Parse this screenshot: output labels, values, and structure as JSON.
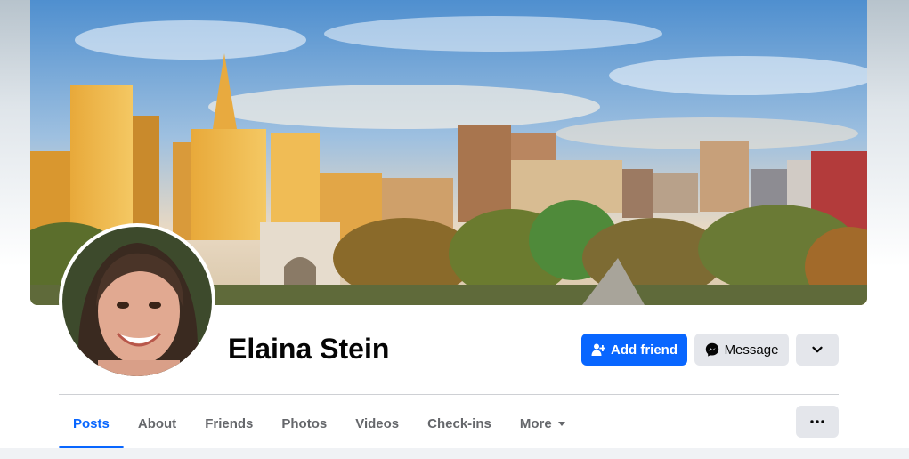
{
  "profile": {
    "name": "Elaina Stein"
  },
  "actions": {
    "add_friend_label": "Add friend",
    "message_label": "Message"
  },
  "tabs": [
    {
      "label": "Posts",
      "active": true
    },
    {
      "label": "About",
      "active": false
    },
    {
      "label": "Friends",
      "active": false
    },
    {
      "label": "Photos",
      "active": false
    },
    {
      "label": "Videos",
      "active": false
    },
    {
      "label": "Check-ins",
      "active": false
    },
    {
      "label": "More",
      "active": false
    }
  ],
  "icons": {
    "add_friend": "person-plus-icon",
    "message": "messenger-icon",
    "expand": "chevron-down-icon",
    "options": "more-horizontal-icon",
    "more_caret": "caret-down-icon"
  },
  "colors": {
    "accent": "#0866ff",
    "secondary_button": "#e4e6eb",
    "text_primary": "#050505",
    "text_secondary": "#65676b",
    "divider": "#ced0d4"
  }
}
